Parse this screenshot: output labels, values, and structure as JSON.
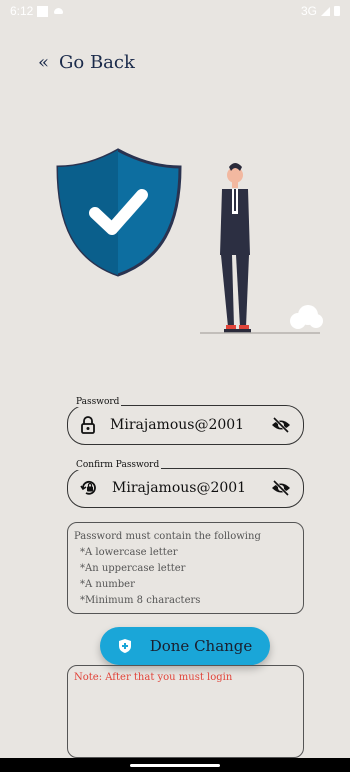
{
  "status_bar": {
    "time": "6:12",
    "network": "3G"
  },
  "header": {
    "back_label": "Go Back"
  },
  "password_field": {
    "label": "Password",
    "value": "Mirajamous@2001"
  },
  "confirm_field": {
    "label": "Confirm Password",
    "value": "Mirajamous@2001"
  },
  "rules": {
    "title": "Password must contain the following",
    "items": [
      "*A lowercase letter",
      "*An uppercase letter",
      "*A number",
      "*Minimum 8 characters"
    ]
  },
  "done_button": {
    "label": "Done Change"
  },
  "note": {
    "text": "Note: After that you must login"
  },
  "colors": {
    "background": "#e8e5e1",
    "accent": "#1aa6d8",
    "note": "#e0443a",
    "shield": "#0d6ea0"
  },
  "icons": [
    "back-icon",
    "lock-icon",
    "eye-off-icon",
    "lock-reset-icon",
    "shield-icon"
  ]
}
